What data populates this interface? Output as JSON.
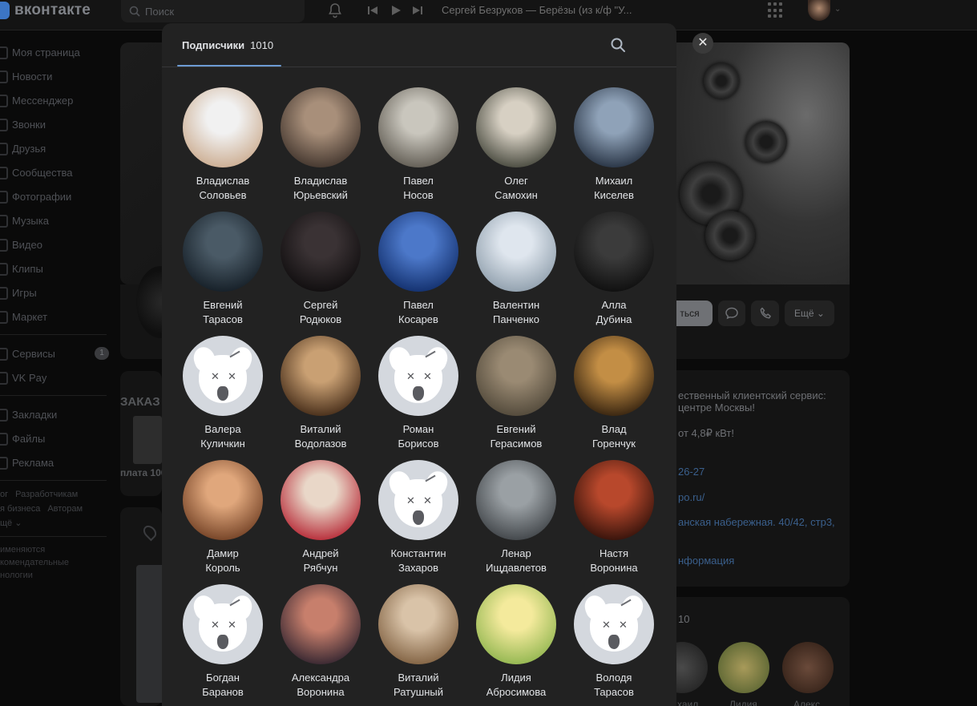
{
  "header": {
    "logo_text": "вконтакте",
    "search_placeholder": "Поиск",
    "player_title": "Сергей Безруков — Берёзы (из к/ф \"У..."
  },
  "sidebar": {
    "items": [
      {
        "label": "Моя страница"
      },
      {
        "label": "Новости"
      },
      {
        "label": "Мессенджер"
      },
      {
        "label": "Звонки"
      },
      {
        "label": "Друзья"
      },
      {
        "label": "Сообщества"
      },
      {
        "label": "Фотографии"
      },
      {
        "label": "Музыка"
      },
      {
        "label": "Видео"
      },
      {
        "label": "Клипы"
      },
      {
        "label": "Игры"
      },
      {
        "label": "Маркет"
      }
    ],
    "services_label": "Сервисы",
    "services_badge": "1",
    "vkpay_label": "VK Pay",
    "items2": [
      {
        "label": "Закладки"
      },
      {
        "label": "Файлы"
      },
      {
        "label": "Реклама"
      }
    ],
    "footer": {
      "blog": "ог",
      "developers": "Разработчикам",
      "business": "я бизнеса",
      "authors": "Авторам",
      "more": "щё ⌄",
      "note1": "именяются",
      "note2": "комендательные",
      "note3": "нологии"
    }
  },
  "background": {
    "message_label": "ться",
    "more_label": "Ещё",
    "info1": "ественный клиентский сервис:",
    "info2": "центре Москвы!",
    "info3": "от 4,8₽ кВт!",
    "phone": "26-27",
    "site": "ро.ru/",
    "address": "анская набережная. 40/42, стр3,",
    "more_info": "нформация",
    "subs_count_peek": "10",
    "promo_title": "ЗАКАЗ",
    "promo_sub": "плата 100",
    "mini_names": [
      "хаил",
      "Лидия",
      "Алекс"
    ]
  },
  "modal": {
    "tab_label": "Подписчики",
    "tab_count": "1010",
    "close_symbol": "✕",
    "followers": [
      {
        "first": "Владислав",
        "last": "Соловьев",
        "avatar": "photo",
        "colors": [
          "#f1f1f1",
          "#c9a88a"
        ]
      },
      {
        "first": "Владислав",
        "last": "Юрьевский",
        "avatar": "photo",
        "colors": [
          "#a88f7a",
          "#3b2f28"
        ]
      },
      {
        "first": "Павел",
        "last": "Носов",
        "avatar": "photo",
        "colors": [
          "#c9c6bd",
          "#59544b"
        ]
      },
      {
        "first": "Олег",
        "last": "Самохин",
        "avatar": "photo",
        "colors": [
          "#d7d0c3",
          "#3d3f34"
        ]
      },
      {
        "first": "Михаил",
        "last": "Киселев",
        "avatar": "photo",
        "colors": [
          "#8fa2b8",
          "#1f2a3a"
        ]
      },
      {
        "first": "Евгений",
        "last": "Тарасов",
        "avatar": "photo",
        "colors": [
          "#4a5a66",
          "#111a22"
        ]
      },
      {
        "first": "Сергей",
        "last": "Родюков",
        "avatar": "photo",
        "colors": [
          "#3a3234",
          "#0d0b0c"
        ]
      },
      {
        "first": "Павел",
        "last": "Косарев",
        "avatar": "photo",
        "colors": [
          "#4c78c9",
          "#0e2a66"
        ]
      },
      {
        "first": "Валентин",
        "last": "Панченко",
        "avatar": "photo",
        "colors": [
          "#dfe6ee",
          "#8a9aa8"
        ]
      },
      {
        "first": "Алла",
        "last": "Дубина",
        "avatar": "photo",
        "colors": [
          "#3b3b3b",
          "#0b0b0b"
        ]
      },
      {
        "first": "Валера",
        "last": "Куличкин",
        "avatar": "deactivated",
        "colors": []
      },
      {
        "first": "Виталий",
        "last": "Водолазов",
        "avatar": "photo",
        "colors": [
          "#c9a073",
          "#3c2412"
        ]
      },
      {
        "first": "Роман",
        "last": "Борисов",
        "avatar": "deactivated",
        "colors": []
      },
      {
        "first": "Евгений",
        "last": "Герасимов",
        "avatar": "photo",
        "colors": [
          "#9a8a73",
          "#4c4436"
        ]
      },
      {
        "first": "Влад",
        "last": "Горенчук",
        "avatar": "photo",
        "colors": [
          "#c38e45",
          "#2a1a0b"
        ]
      },
      {
        "first": "Дамир",
        "last": "Король",
        "avatar": "photo",
        "colors": [
          "#e0a77c",
          "#6b3a1f"
        ]
      },
      {
        "first": "Андрей",
        "last": "Рябчун",
        "avatar": "photo",
        "colors": [
          "#e9d7c8",
          "#b31d2c"
        ]
      },
      {
        "first": "Константин",
        "last": "Захаров",
        "avatar": "deactivated",
        "colors": []
      },
      {
        "first": "Ленар",
        "last": "Ищдавлетов",
        "avatar": "photo",
        "colors": [
          "#9aa0a4",
          "#3a3e42"
        ]
      },
      {
        "first": "Настя",
        "last": "Воронина",
        "avatar": "photo",
        "colors": [
          "#b8482c",
          "#2a0e08"
        ]
      },
      {
        "first": "Богдан",
        "last": "Баранов",
        "avatar": "deactivated",
        "colors": []
      },
      {
        "first": "Александра",
        "last": "Воронина",
        "avatar": "photo",
        "colors": [
          "#c77f6c",
          "#2a1f2c"
        ]
      },
      {
        "first": "Виталий",
        "last": "Ратушный",
        "avatar": "photo",
        "colors": [
          "#d9c3a8",
          "#7a5a3a"
        ]
      },
      {
        "first": "Лидия",
        "last": "Абросимова",
        "avatar": "photo",
        "colors": [
          "#f4ea9c",
          "#8ab24a"
        ]
      },
      {
        "first": "Володя",
        "last": "Тарасов",
        "avatar": "deactivated",
        "colors": []
      }
    ]
  }
}
